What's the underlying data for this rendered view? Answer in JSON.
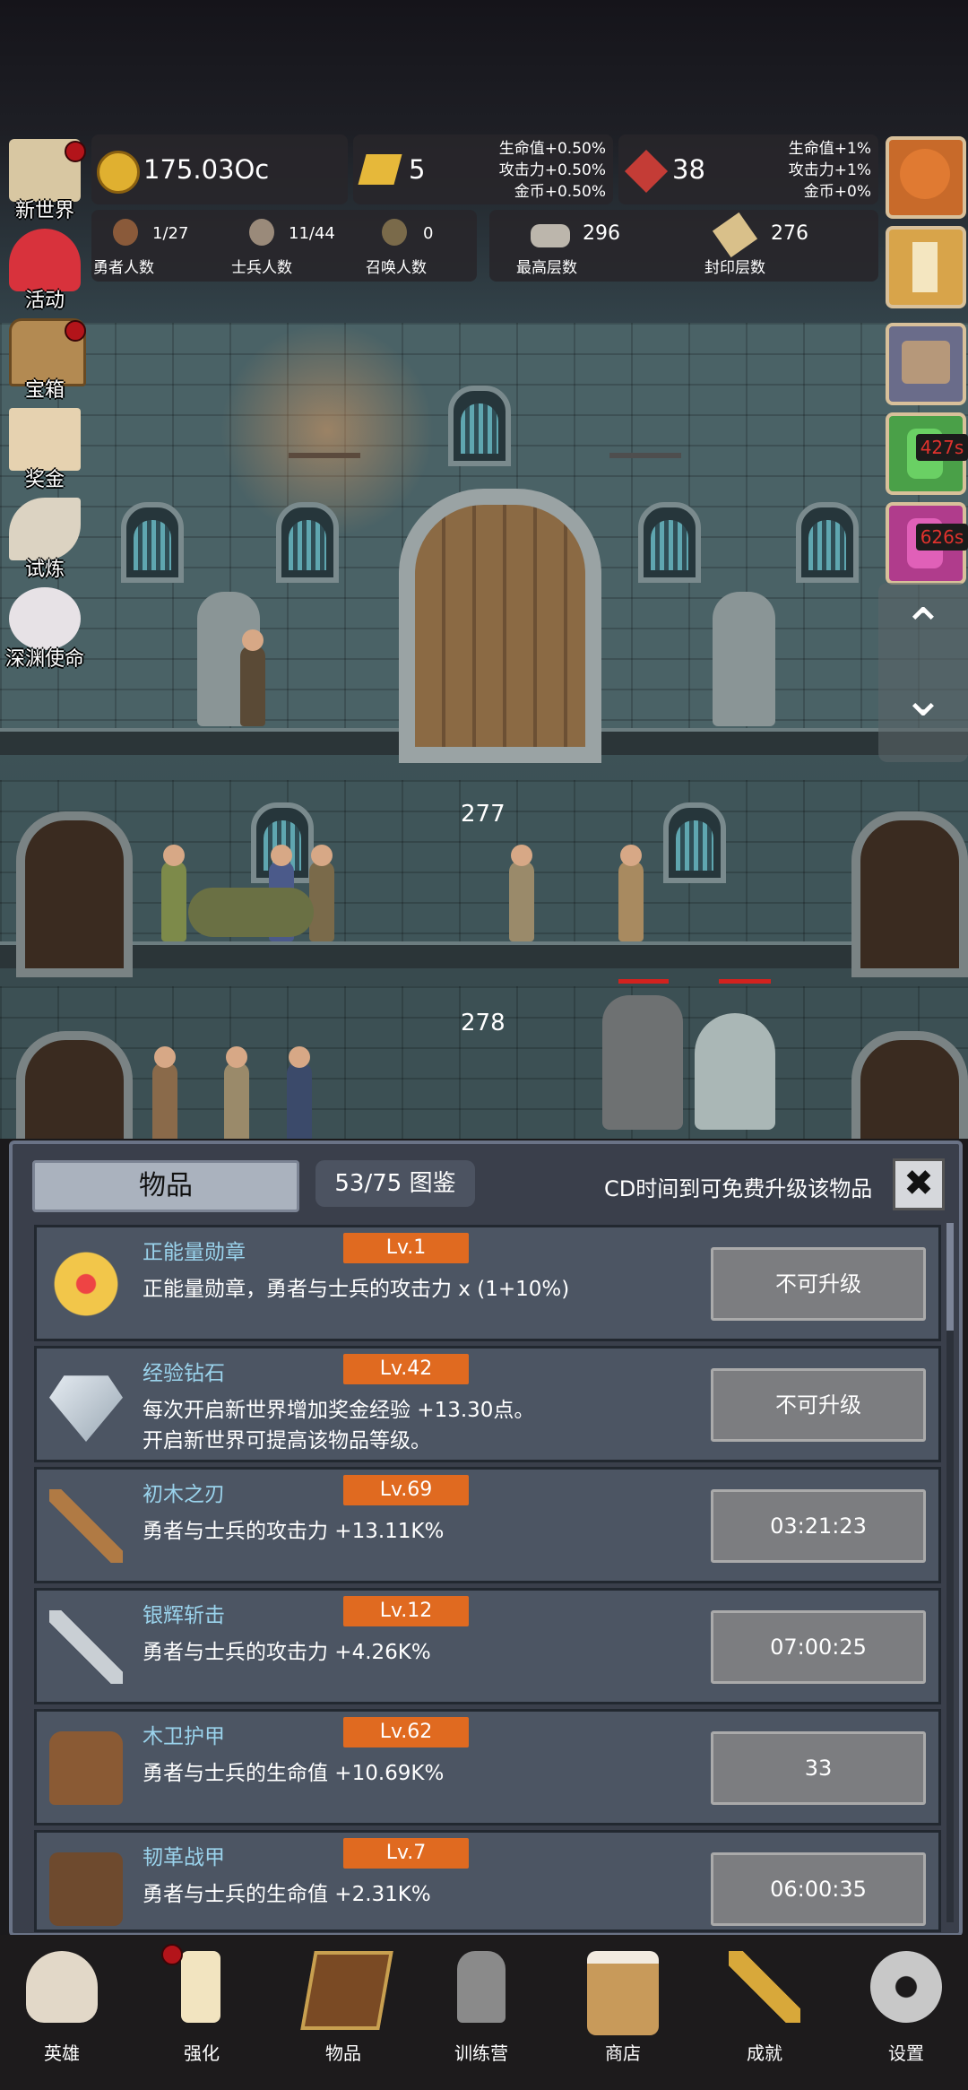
{
  "resources": {
    "gold": "175.03Oc",
    "bars": "5",
    "bars_bonus": [
      "生命值+0.50%",
      "攻击力+0.50%",
      "金币+0.50%"
    ],
    "gems": "38",
    "gems_bonus": [
      "生命值+1%",
      "攻击力+1%",
      "金币+0%"
    ]
  },
  "stats": {
    "heroes_value": "1/27",
    "heroes_label": "勇者人数",
    "soldiers_value": "11/44",
    "soldiers_label": "士兵人数",
    "summons_value": "0",
    "summons_label": "召唤人数",
    "max_floor_value": "296",
    "max_floor_label": "最高层数",
    "sealed_value": "276",
    "sealed_label": "封印层数"
  },
  "side_menu": [
    {
      "label": "新世界",
      "icon": "map-icon",
      "dot": true
    },
    {
      "label": "活动",
      "icon": "heart-icon",
      "dot": false
    },
    {
      "label": "宝箱",
      "icon": "chest-icon",
      "dot": true
    },
    {
      "label": "奖金",
      "icon": "envelope-icon",
      "dot": false
    },
    {
      "label": "试炼",
      "icon": "feather-icon",
      "dot": false
    },
    {
      "label": "深渊使命",
      "icon": "pearl-icon",
      "dot": false
    }
  ],
  "right_menu": {
    "timer1": "427s",
    "timer2": "626s",
    "up_arrow": "⌃",
    "down_arrow": "⌄"
  },
  "floors": {
    "floor_a": "277",
    "floor_b": "278"
  },
  "item_panel": {
    "tab_label": "物品",
    "collection": "53/75 图鉴",
    "cd_note": "CD时间到可免费升级该物品",
    "close": "✖",
    "items": [
      {
        "name": "正能量勋章",
        "level": "Lv.1",
        "desc": "正能量勋章，勇者与士兵的攻击力 x (1+10%)",
        "action": "不可升级",
        "icon": "crown-medal-icon"
      },
      {
        "name": "经验钻石",
        "level": "Lv.42",
        "desc": "每次开启新世界增加奖金经验 +13.30点。",
        "desc2": "开启新世界可提高该物品等级。",
        "action": "不可升级",
        "icon": "diamond-icon"
      },
      {
        "name": "初木之刃",
        "level": "Lv.69",
        "desc": "勇者与士兵的攻击力 +13.11K%",
        "action": "03:21:23",
        "icon": "wooden-sword-icon"
      },
      {
        "name": "银辉斩击",
        "level": "Lv.12",
        "desc": "勇者与士兵的攻击力 +4.26K%",
        "action": "07:00:25",
        "icon": "silver-sword-icon"
      },
      {
        "name": "木卫护甲",
        "level": "Lv.62",
        "desc": "勇者与士兵的生命值 +10.69K%",
        "action": "33",
        "icon": "leather-armor-icon"
      },
      {
        "name": "韧革战甲",
        "level": "Lv.7",
        "desc": "勇者与士兵的生命值 +2.31K%",
        "action": "06:00:35",
        "icon": "backpack-armor-icon"
      }
    ]
  },
  "bottom_nav": [
    {
      "label": "英雄",
      "icon": "skull-icon"
    },
    {
      "label": "强化",
      "icon": "candle-icon",
      "dot": true
    },
    {
      "label": "物品",
      "icon": "book-icon"
    },
    {
      "label": "训练营",
      "icon": "lantern-icon"
    },
    {
      "label": "商店",
      "icon": "beer-mug-icon"
    },
    {
      "label": "成就",
      "icon": "key-icon"
    },
    {
      "label": "设置",
      "icon": "gear-icon"
    }
  ],
  "colors": {
    "accent_orange": "#e06a20",
    "name_blue": "#9ad3ec",
    "panel_bg": "#3a3f4b",
    "timer_red": "#e0322d"
  }
}
